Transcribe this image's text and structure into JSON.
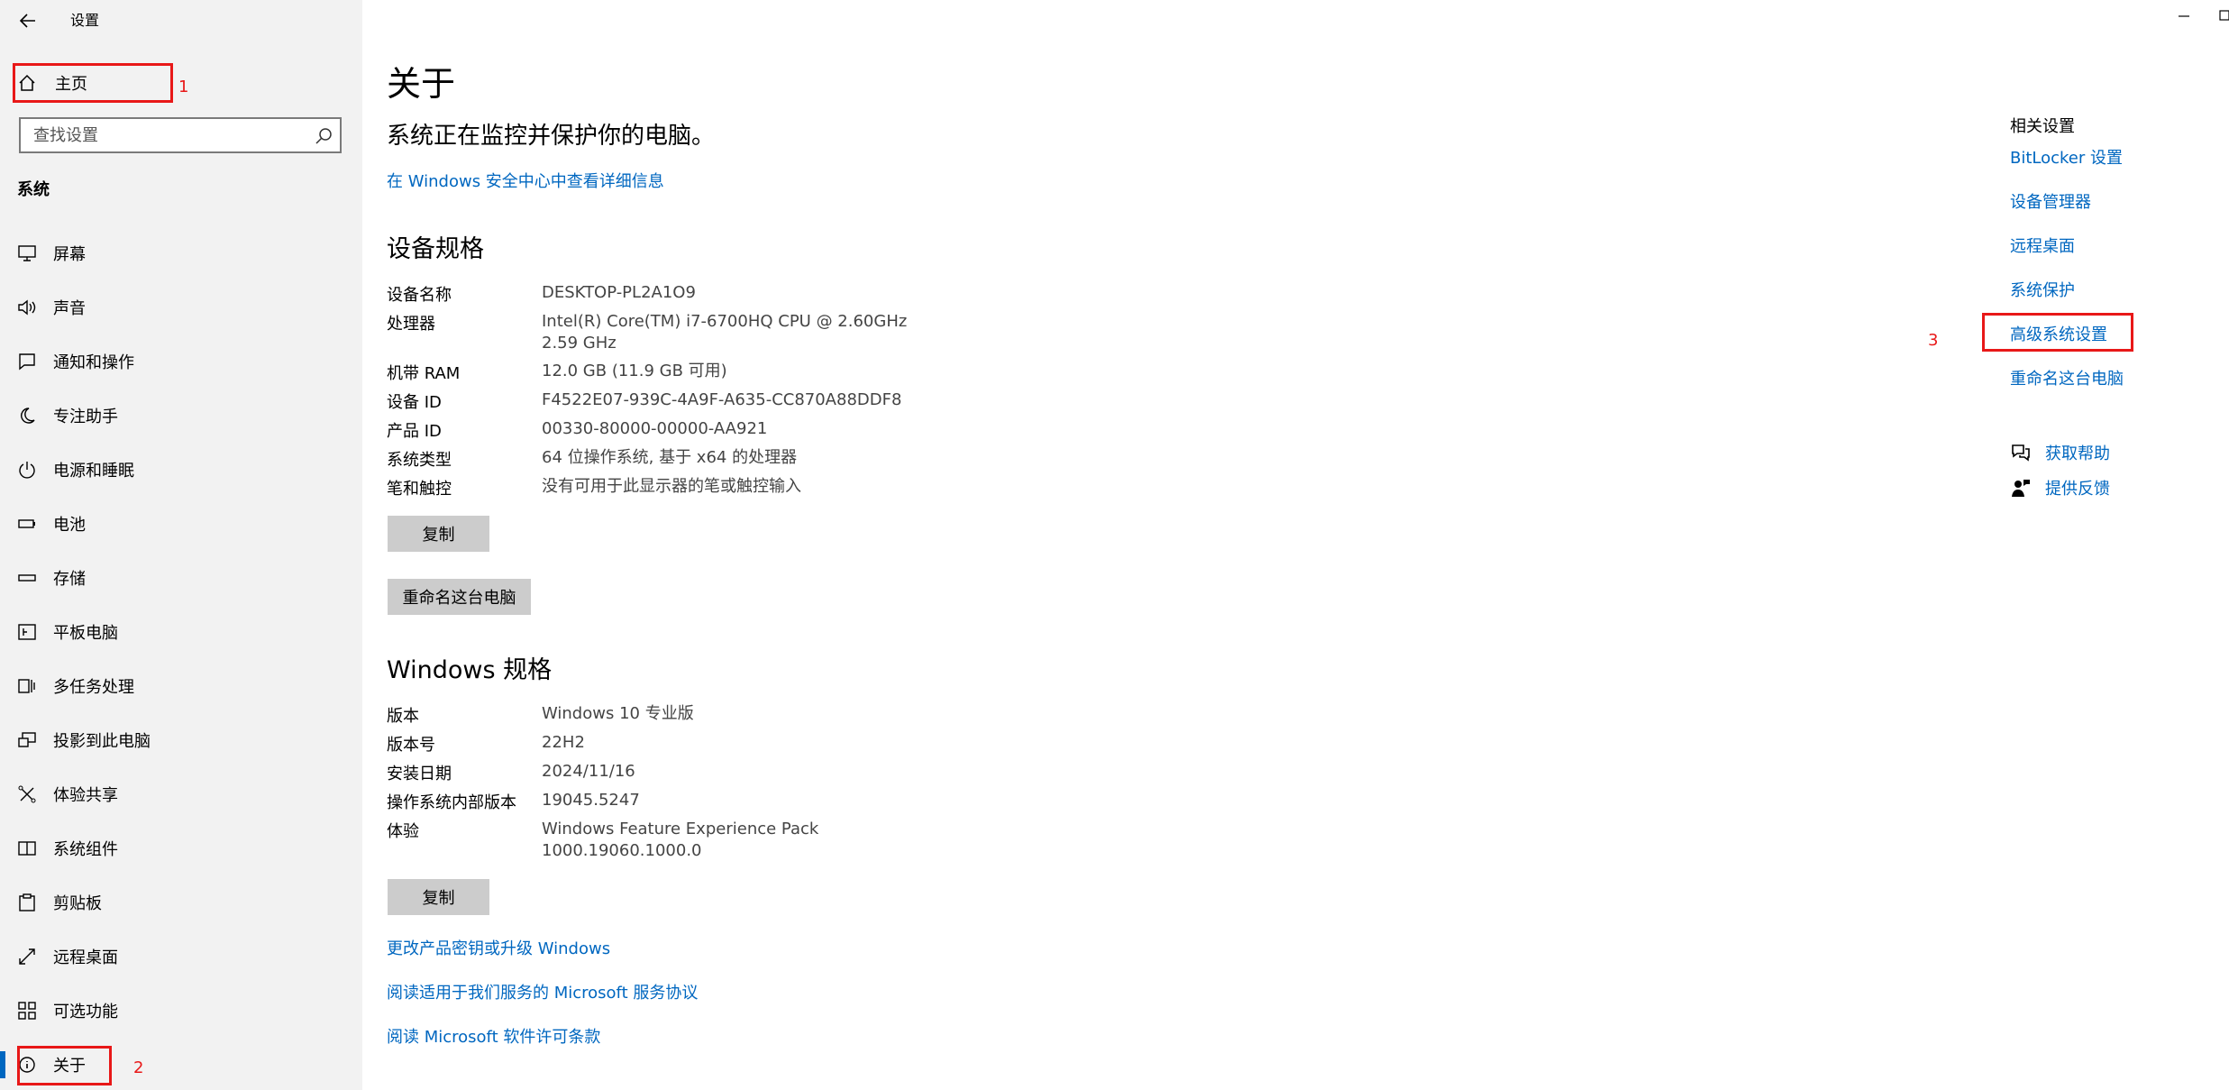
{
  "window": {
    "title": "设置"
  },
  "sidebar": {
    "home_label": "主页",
    "search_placeholder": "查找设置",
    "section_title": "系统",
    "items": [
      {
        "label": "屏幕",
        "icon": "monitor-icon"
      },
      {
        "label": "声音",
        "icon": "speaker-icon"
      },
      {
        "label": "通知和操作",
        "icon": "notification-icon"
      },
      {
        "label": "专注助手",
        "icon": "moon-icon"
      },
      {
        "label": "电源和睡眠",
        "icon": "power-icon"
      },
      {
        "label": "电池",
        "icon": "battery-icon"
      },
      {
        "label": "存储",
        "icon": "storage-icon"
      },
      {
        "label": "平板电脑",
        "icon": "tablet-icon"
      },
      {
        "label": "多任务处理",
        "icon": "multitask-icon"
      },
      {
        "label": "投影到此电脑",
        "icon": "project-icon"
      },
      {
        "label": "体验共享",
        "icon": "share-icon"
      },
      {
        "label": "系统组件",
        "icon": "components-icon"
      },
      {
        "label": "剪贴板",
        "icon": "clipboard-icon"
      },
      {
        "label": "远程桌面",
        "icon": "remote-icon"
      },
      {
        "label": "可选功能",
        "icon": "features-icon"
      },
      {
        "label": "关于",
        "icon": "info-icon",
        "active": true
      }
    ]
  },
  "annotations": {
    "n1": "1",
    "n2": "2",
    "n3": "3",
    "color": "#e81818"
  },
  "main": {
    "title": "关于",
    "protect_text": "系统正在监控并保护你的电脑。",
    "security_link": "在 Windows 安全中心中查看详细信息",
    "device_specs": {
      "title": "设备规格",
      "rows": [
        {
          "key": "设备名称",
          "value": "DESKTOP-PL2A1O9"
        },
        {
          "key": "处理器",
          "value": "Intel(R) Core(TM) i7-6700HQ CPU @ 2.60GHz",
          "value2": "2.59 GHz"
        },
        {
          "key": "机带 RAM",
          "value": "12.0 GB (11.9 GB 可用)"
        },
        {
          "key": "设备 ID",
          "value": "F4522E07-939C-4A9F-A635-CC870A88DDF8"
        },
        {
          "key": "产品 ID",
          "value": "00330-80000-00000-AA921"
        },
        {
          "key": "系统类型",
          "value": "64 位操作系统, 基于 x64 的处理器"
        },
        {
          "key": "笔和触控",
          "value": "没有可用于此显示器的笔或触控输入"
        }
      ],
      "copy_button": "复制",
      "rename_button": "重命名这台电脑"
    },
    "windows_specs": {
      "title": "Windows 规格",
      "rows": [
        {
          "key": "版本",
          "value": "Windows 10 专业版"
        },
        {
          "key": "版本号",
          "value": "22H2"
        },
        {
          "key": "安装日期",
          "value": "2024/11/16"
        },
        {
          "key": "操作系统内部版本",
          "value": "19045.5247"
        },
        {
          "key": "体验",
          "value": "Windows Feature Experience Pack",
          "value2": "1000.19060.1000.0"
        }
      ],
      "copy_button": "复制"
    },
    "links": {
      "product_key": "更改产品密钥或升级 Windows",
      "service_agreement": "阅读适用于我们服务的 Microsoft 服务协议",
      "license_terms": "阅读 Microsoft 软件许可条款"
    }
  },
  "related": {
    "title": "相关设置",
    "links": [
      "BitLocker 设置",
      "设备管理器",
      "远程桌面",
      "系统保护",
      "高级系统设置",
      "重命名这台电脑"
    ],
    "get_help": "获取帮助",
    "feedback": "提供反馈"
  },
  "colors": {
    "accent": "#0067c0",
    "sidebar_bg": "#f2f2f2",
    "button_bg": "#cccccc"
  }
}
